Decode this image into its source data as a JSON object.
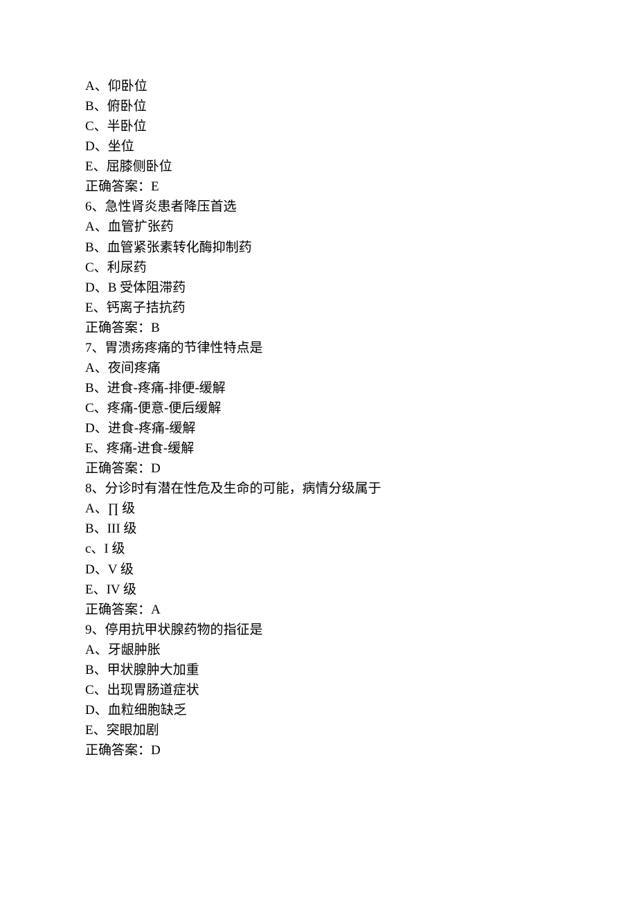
{
  "lines": [
    "A、仰卧位",
    "B、俯卧位",
    "C、半卧位",
    "D、坐位",
    "E、屈膝侧卧位"
  ],
  "answer5": {
    "label": "正确答案：",
    "value": "E"
  },
  "q6": {
    "stem": "6、急性肾炎患者降压首选",
    "opts": [
      "A、血管扩张药",
      "B、血管紧张素转化酶抑制药",
      "C、利尿药",
      "D、B 受体阻滞药",
      "E、钙离子拮抗药"
    ],
    "answer": {
      "label": "正确答案：",
      "value": "B"
    }
  },
  "q7": {
    "stem": "7、胃溃疡疼痛的节律性特点是",
    "opts": [
      "A、夜间疼痛",
      "B、进食-疼痛-排便-缓解",
      "C、疼痛-便意-便后缓解",
      "D、进食-疼痛-缓解",
      "E、疼痛-进食-缓解"
    ],
    "answer": {
      "label": "正确答案：",
      "value": "D"
    }
  },
  "q8": {
    "stem": "8、分诊时有潜在性危及生命的可能，病情分级属于",
    "opts": [
      "A、∏ 级",
      "B、III 级",
      "c、I 级",
      "D、V 级",
      "E、IV 级"
    ],
    "answer": {
      "label": "正确答案：",
      "value": "A"
    }
  },
  "q9": {
    "stem": "9、停用抗甲状腺药物的指征是",
    "opts": [
      "A、牙龈肿胀",
      "B、甲状腺肿大加重",
      "C、出现胃肠道症状",
      "D、血粒细胞缺乏",
      "E、突眼加剧"
    ],
    "answer": {
      "label": "正确答案：",
      "value": "D"
    }
  }
}
